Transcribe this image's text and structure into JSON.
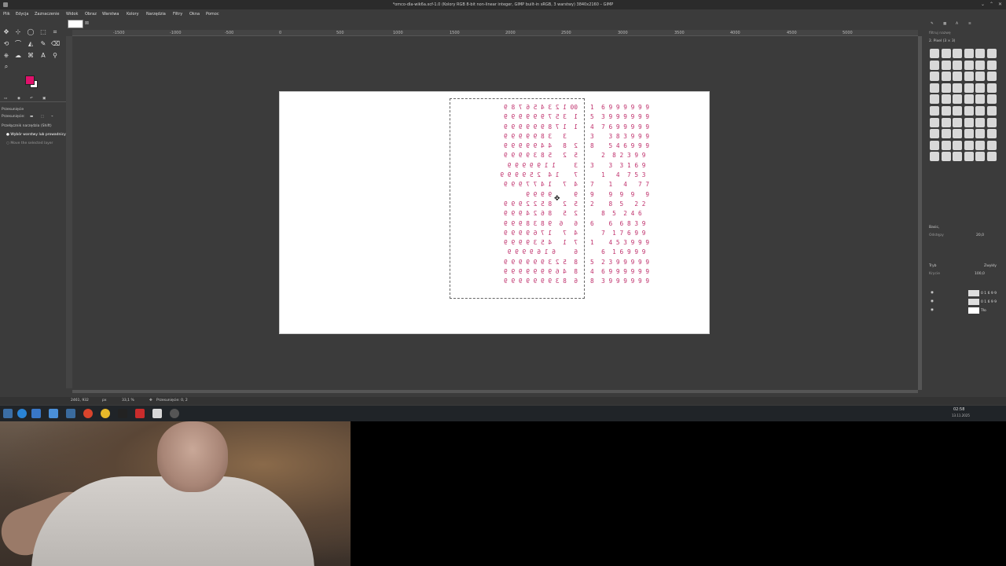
{
  "window": {
    "title": "*omco-dla-wik6a.xcf-1.0 (Kolory RGB 8-bit non-linear integer, GIMP built-in sRGB, 3 warstwy) 3840x2160 – GIMP"
  },
  "menu": [
    "Plik",
    "Edycja",
    "Zaznaczenie",
    "Widok",
    "Obraz",
    "Warstwa",
    "Kolory",
    "Narzędzia",
    "Filtry",
    "Okna",
    "Pomoc"
  ],
  "ruler": {
    "ticks": [
      "-1500",
      "-1000",
      "-500",
      "0",
      "500",
      "1000",
      "1500",
      "2000",
      "2500",
      "3000",
      "3500",
      "4000",
      "4500",
      "5000"
    ]
  },
  "tool_options": {
    "title": "Przesunięcie",
    "mode_label": "Przesunięcie:",
    "switch_label": "Przełącznik narzędzia (Shift)",
    "radio_label": "Wybór warstwy lub prowadnicy",
    "radio2_label": "Move the selected layer"
  },
  "colors": {
    "foreground": "#e0116b",
    "background": "#ffffff",
    "digit_color": "#c0336e"
  },
  "grid_mirrored": [
    "00 1 2 3 4 5 6 7 8 9",
    "1  3 5 7 9 9 9 9 9 9",
    "1  1 7 8 9 9 9 9 9 9",
    "   3   3 8 9 9 9 9 9",
    "2  8   4 4 9 9 9 9 9",
    "5  2   5 8 3 9 9 9 9",
    "3     1 1 9 9 9 9 9",
    "7    1 4  2 5 9 9 9 9",
    "4  7   1 4 7 7 9 9 9",
    "9      9 9 9 9",
    "5  2   8 5 2 2 9 9 9",
    "2  5   8 6 2 4 9 9 9",
    "6   6  9 8 3 8 9 9 9",
    "4  7   1 7 6 9 9 9 9",
    "7  1   4 5 3 9 9 9 9",
    "6     6 1 6 9 9 9 9",
    "8  5 2 3 9 9 9 9 9 9",
    "8  4 6 9 9 9 9 9 9 9",
    "6  8 3 9 9 9 9 9 9 9"
  ],
  "grid_normal": [
    "1  6 9 9 9 9 9 9",
    "5  3 9 9 9 9 9 9",
    "4  7 6 9 9 9 9 9",
    "3    3 8 3 9 9 9",
    "8    5 4 6 9 9 9",
    "   2  8 2 3 9 9",
    "3    3  3 1 6 9",
    "   1   4  7 5 3",
    "7    1   4   7 7",
    "9    9  9  9   9",
    "2    8  5   2 2",
    "   8  5  2 4 6",
    "6    6  6 8 3 9",
    "   7  1 7 6 9 9",
    "1    4 5 3 9 9 9",
    "   6  1 6 9 9 9",
    "5  2 3 9 9 9 9 9",
    "4  6 9 9 9 9 9 9",
    "8  3 9 9 9 9 9 9"
  ],
  "right_panel": {
    "filter_label": "filtruj nazwę",
    "brush_name": "2. Pixel (3 × 3)",
    "preset_label": "Basic,",
    "spacing_label": "Odstępy",
    "spacing_value": "20,0",
    "mode_label": "Tryb",
    "mode_value": "Zwykły",
    "opacity_label": "Krycie",
    "opacity_value": "100,0",
    "layers": [
      {
        "name": "0 1 6 9 9"
      },
      {
        "name": "0 1 6 9 9"
      },
      {
        "name": "Tło"
      }
    ]
  },
  "status": {
    "coords": "2461, 932",
    "unit": "px",
    "zoom": "33,1 %",
    "message": "Przesunięcie: 0, 2"
  },
  "taskbar": {
    "time": "02:58",
    "date": "13.11.2025"
  }
}
